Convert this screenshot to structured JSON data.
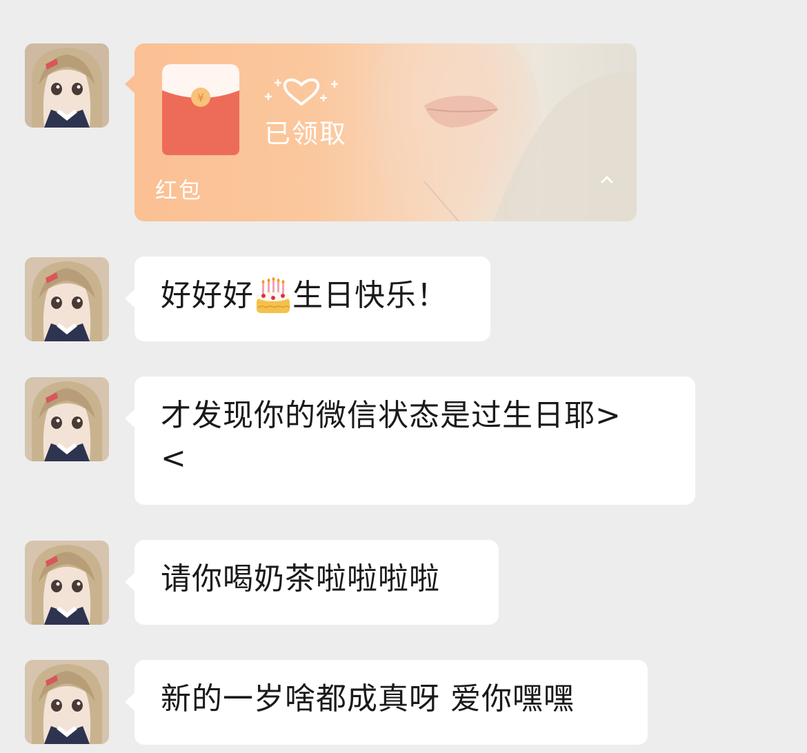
{
  "red_packet": {
    "status": "已领取",
    "label": "红包",
    "currency_symbol": "¥",
    "envelope_color": "#ed6c58",
    "accent_color": "#fbc093"
  },
  "messages": [
    {
      "parts": [
        "好好好",
        "生日快乐！"
      ],
      "emoji": "birthday-cake"
    },
    {
      "text": "才发现你的微信状态是过生日耶>\n<"
    },
    {
      "text": "请你喝奶茶啦啦啦啦"
    },
    {
      "text": "新的一岁啥都成真呀 爱你嘿嘿"
    }
  ]
}
